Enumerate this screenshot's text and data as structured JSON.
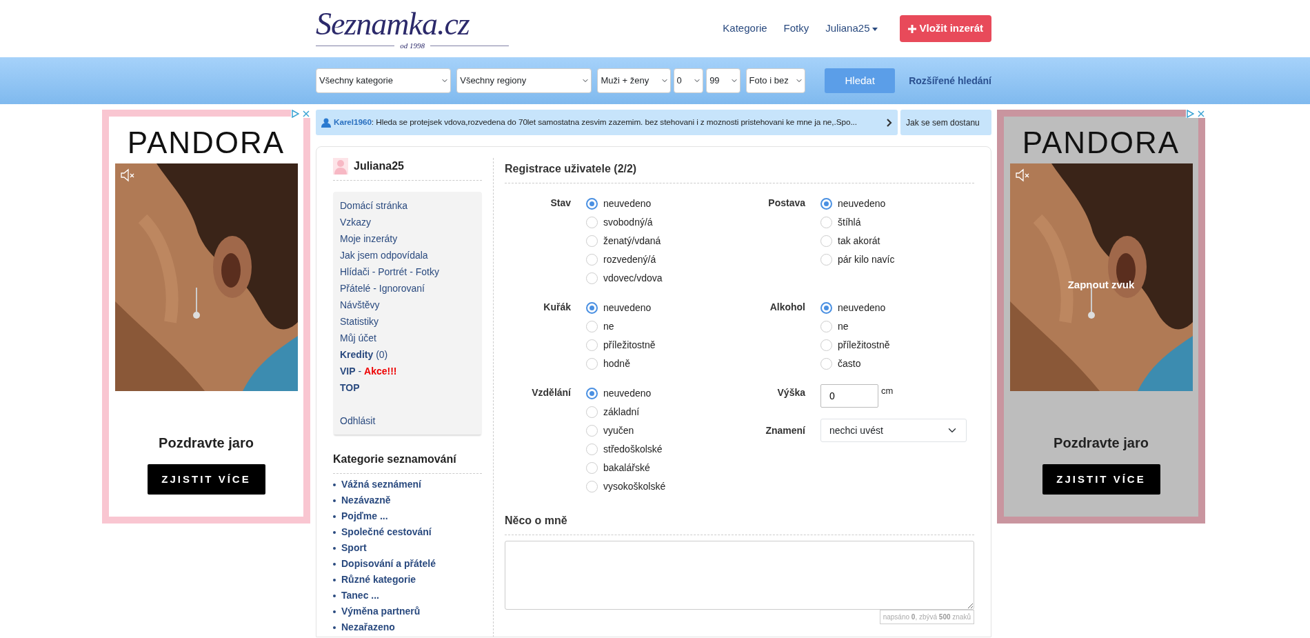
{
  "header": {
    "logo": "Seznamka.cz",
    "tagline": "od 1998",
    "nav": [
      {
        "label": "Kategorie",
        "kind": "link"
      },
      {
        "label": "Fotky",
        "kind": "link"
      },
      {
        "label": "Juliana25",
        "kind": "dropdown"
      }
    ],
    "post_button": "Vložit inzerát"
  },
  "search_bar": {
    "filters": [
      "Všechny kategorie",
      "Všechny regiony",
      "Muži + ženy",
      "0",
      "99",
      "Foto i bez"
    ],
    "search_button": "Hledat",
    "advanced_link": "Rozšířené hledání"
  },
  "ticker": {
    "user": "Karel1960",
    "message": ": Hleda se protejsek vdova,rozvedena do 70let samostatna zesvim zazemim. bez stehovani i z moznosti pristehovani ke mne ja ne,.Spo...",
    "side_link": "Jak se sem dostanu"
  },
  "ads": [
    {
      "brand": "PANDORA",
      "headline": "Pozdravte jaro",
      "cta": "ZJISTIT VÍCE",
      "color": "#f9c6d1",
      "dimmed": false
    },
    {
      "brand": "PANDORA",
      "headline": "Pozdravte jaro",
      "cta": "ZJISTIT VÍCE",
      "color": "#c9959f",
      "dimmed": true,
      "sound_hint": "Zapnout zvuk"
    }
  ],
  "profile": {
    "username": "Juliana25",
    "menu": [
      {
        "parts": [
          {
            "text": "Domácí stránka",
            "kind": "plain"
          }
        ]
      },
      {
        "parts": [
          {
            "text": "Vzkazy",
            "kind": "plain"
          }
        ]
      },
      {
        "parts": [
          {
            "text": "Moje inzeráty",
            "kind": "plain"
          }
        ]
      },
      {
        "parts": [
          {
            "text": "Jak jsem odpovídala",
            "kind": "plain"
          }
        ]
      },
      {
        "parts": [
          {
            "text": "Hlídači - Portrét - Fotky",
            "kind": "plain"
          }
        ]
      },
      {
        "parts": [
          {
            "text": "Přátelé - Ignorovaní",
            "kind": "plain"
          }
        ]
      },
      {
        "parts": [
          {
            "text": "Návštěvy",
            "kind": "plain"
          }
        ]
      },
      {
        "parts": [
          {
            "text": "Statistiky",
            "kind": "plain"
          }
        ]
      },
      {
        "parts": [
          {
            "text": "Můj účet",
            "kind": "plain"
          }
        ]
      },
      {
        "parts": [
          {
            "text": "Kredity",
            "kind": "bold"
          },
          {
            "text": "(0)",
            "kind": "plain"
          }
        ]
      },
      {
        "parts": [
          {
            "text": "VIP",
            "kind": "bold"
          },
          {
            "text": "-",
            "kind": "plain"
          },
          {
            "text": "Akce!!!",
            "kind": "alert"
          }
        ]
      },
      {
        "parts": [
          {
            "text": "TOP",
            "kind": "bold"
          }
        ]
      },
      {
        "parts": [
          {
            "text": "Odhlásit",
            "kind": "plain"
          }
        ],
        "spaced": true
      }
    ]
  },
  "categories": {
    "title": "Kategorie seznamování",
    "items": [
      "Vážná seznámení",
      "Nezávazně",
      "Pojďme ...",
      "Společné cestování",
      "Sport",
      "Dopisování a přátelé",
      "Různé kategorie",
      "Tanec ...",
      "Výměna partnerů",
      "Nezařazeno"
    ]
  },
  "form": {
    "title": "Registrace uživatele (2/2)",
    "rows": [
      {
        "left": [
          {
            "kind": "radio",
            "label": "Stav",
            "options": [
              {
                "label": "neuvedeno",
                "selected": true
              },
              {
                "label": "svobodný/á",
                "selected": false
              },
              {
                "label": "ženatý/vdaná",
                "selected": false
              },
              {
                "label": "rozvedený/á",
                "selected": false
              },
              {
                "label": "vdovec/vdova",
                "selected": false
              }
            ]
          }
        ],
        "right": [
          {
            "kind": "radio",
            "label": "Postava",
            "options": [
              {
                "label": "neuvedeno",
                "selected": true
              },
              {
                "label": "štíhlá",
                "selected": false
              },
              {
                "label": "tak akorát",
                "selected": false
              },
              {
                "label": "pár kilo navíc",
                "selected": false
              }
            ]
          }
        ]
      },
      {
        "left": [
          {
            "kind": "radio",
            "label": "Kuřák",
            "options": [
              {
                "label": "neuvedeno",
                "selected": true
              },
              {
                "label": "ne",
                "selected": false
              },
              {
                "label": "příležitostně",
                "selected": false
              },
              {
                "label": "hodně",
                "selected": false
              }
            ]
          }
        ],
        "right": [
          {
            "kind": "radio",
            "label": "Alkohol",
            "options": [
              {
                "label": "neuvedeno",
                "selected": true
              },
              {
                "label": "ne",
                "selected": false
              },
              {
                "label": "příležitostně",
                "selected": false
              },
              {
                "label": "často",
                "selected": false
              }
            ]
          }
        ]
      },
      {
        "left": [
          {
            "kind": "radio",
            "label": "Vzdělání",
            "options": [
              {
                "label": "neuvedeno",
                "selected": true
              },
              {
                "label": "základní",
                "selected": false
              },
              {
                "label": "vyučen",
                "selected": false
              },
              {
                "label": "středoškolské",
                "selected": false
              },
              {
                "label": "bakalářské",
                "selected": false
              },
              {
                "label": "vysokoškolské",
                "selected": false
              }
            ]
          }
        ],
        "right": [
          {
            "kind": "number",
            "label": "Výška",
            "value": "0",
            "unit": "cm"
          },
          {
            "kind": "select",
            "label": "Znamení",
            "value": "nechci uvést"
          }
        ]
      }
    ]
  },
  "about": {
    "title": "Něco o mně",
    "counter": "napsáno **0**, zbývá **500** znaků"
  }
}
